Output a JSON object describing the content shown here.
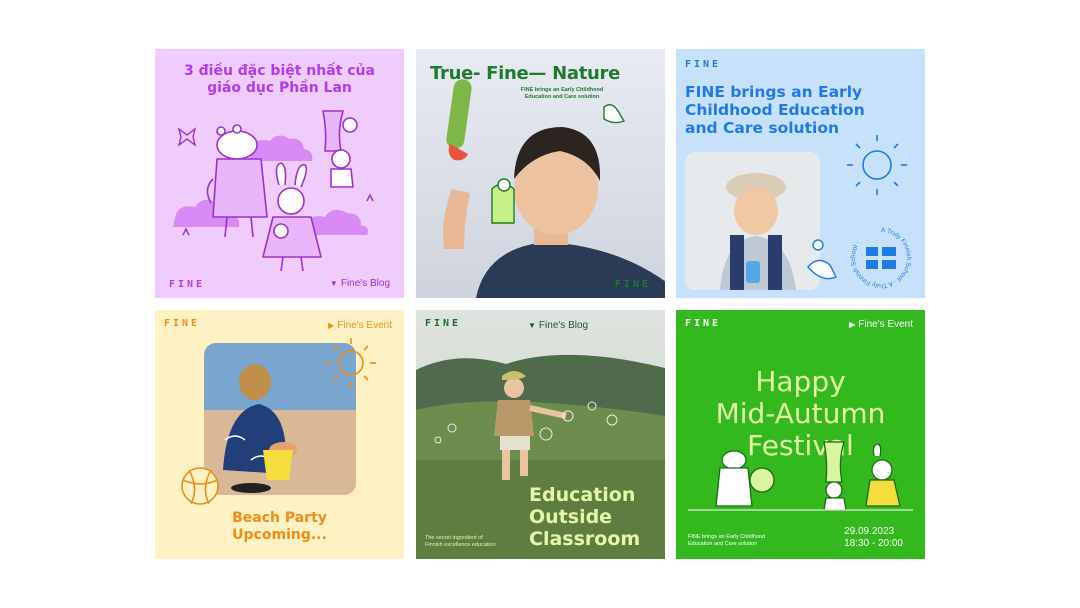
{
  "brand": {
    "logo": "FINE"
  },
  "colors": {
    "lilac_bg": "#efccfb",
    "lilac_ink": "#b43bea",
    "blue_bg": "#c7e1fb",
    "blue_ink": "#1f7ae4",
    "cream_bg": "#fef2c4",
    "orange_ink": "#f08d16",
    "green_bg": "#33b81e",
    "green_ink": "#1e7a2e",
    "lime_ink": "#e4f9a6"
  },
  "posts": [
    {
      "title_line1": "3 điều đặc biệt nhất của",
      "title_line2": "giáo dục Phần Lan",
      "tag": "Fine's Blog",
      "tag_icon": "triangle-down-icon"
    },
    {
      "title": "True- Fine— Nature",
      "subtitle_line1": "FINE brings an Early Childhood",
      "subtitle_line2": "Education and Care solution"
    },
    {
      "title_line1": "FINE brings an Early",
      "title_line2": "Childhood Education",
      "title_line3": "and Care solution",
      "badge_text": "A Truly Finnish School · A Truly Finnish School ·"
    },
    {
      "tag": "Fine's Event",
      "tag_icon": "flag-icon",
      "title_line1": "Beach Party",
      "title_line2": "Upcoming..."
    },
    {
      "tag": "Fine's Blog",
      "tag_icon": "triangle-down-icon",
      "title_line1": "Education",
      "title_line2": "Outside",
      "title_line3": "Classroom",
      "caption_line1": "The secret ingredient of",
      "caption_line2": "Finnish excellence education"
    },
    {
      "tag": "Fine's Event",
      "tag_icon": "flag-icon",
      "title_line1": "Happy",
      "title_line2": "Mid-Autumn",
      "title_line3": "Festival",
      "footer_line1": "FINE brings an Early Childhood",
      "footer_line2": "Education and Care solution",
      "date": "29.09.2023",
      "time": "18:30 - 20:00"
    }
  ]
}
